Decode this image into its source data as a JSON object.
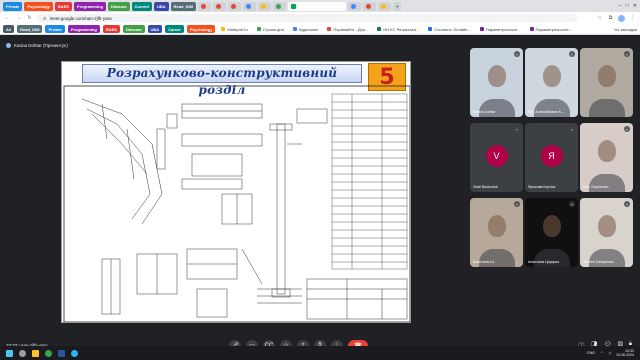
{
  "browser": {
    "tabs": [
      {
        "label": "Private",
        "color": "#1e88e5"
      },
      {
        "label": "Psychology",
        "color": "#f4511e"
      },
      {
        "label": "RAES",
        "color": "#e53935"
      },
      {
        "label": "Programming",
        "color": "#8e24aa"
      },
      {
        "label": "Dhasma",
        "color": "#43a047"
      },
      {
        "label": "Current",
        "color": "#00897b"
      },
      {
        "label": "UBA",
        "color": "#3949ab"
      },
      {
        "label": "Read_DIM",
        "color": "#546e7a"
      }
    ],
    "url": "meet.google.com/nan-zjfb-yasc",
    "bookmarks": [
      {
        "label": "All",
        "color": "#455a64",
        "colored": true
      },
      {
        "label": "Read_DIM",
        "color": "#546e7a",
        "colored": true
      },
      {
        "label": "Private",
        "color": "#1e88e5",
        "colored": true
      },
      {
        "label": "Programming",
        "color": "#8e24aa",
        "colored": true
      },
      {
        "label": "RAES",
        "color": "#e53935",
        "colored": true
      },
      {
        "label": "Dhasma",
        "color": "#43a047",
        "colored": true
      },
      {
        "label": "UBA",
        "color": "#3949ab",
        "colored": true
      },
      {
        "label": "Career",
        "color": "#00897b",
        "colored": true
      },
      {
        "label": "Psychology",
        "color": "#f4511e",
        "colored": true
      },
      {
        "label": "Mathprof.ru",
        "color": "#fbbc04",
        "colored": false
      },
      {
        "label": "Строки дня",
        "color": "#34a853",
        "colored": false
      },
      {
        "label": "Кудинопис",
        "color": "#4285f4",
        "colored": false
      },
      {
        "label": "Порівняйте - Дер...",
        "color": "#ea4335",
        "colored": false
      },
      {
        "label": "НН КС Рятувальн...",
        "color": "#0b8043",
        "colored": false
      },
      {
        "label": "Coursera: Онлайн...",
        "color": "#1a73e8",
        "colored": false
      },
      {
        "label": "Параметричносе...",
        "color": "#7b1fa2",
        "colored": false
      },
      {
        "label": "Параметричносте...",
        "color": "#7b1fa2",
        "colored": false
      }
    ],
    "all_bookmarks": "Усі закладки"
  },
  "meet": {
    "presenter": "Karina Dohtar (Презентує)",
    "meeting_code": "10:33 | nan-zjfb-yasc",
    "slide": {
      "title": "Розрахунково-конструктивний розділ",
      "number": "5"
    },
    "participants": [
      {
        "name": "Karina Dohtar",
        "kind": "video",
        "bg": "#c9d3de"
      },
      {
        "name": "Ігор Анатолійович К...",
        "kind": "video",
        "bg": "#cfd8dc"
      },
      {
        "name": "",
        "kind": "video",
        "bg": "#b0a9a0"
      },
      {
        "name": "Vladi Bochchuk",
        "kind": "letter",
        "letter": "V",
        "bg": "#3c4043"
      },
      {
        "name": "Ярослав Кортюк",
        "kind": "letter",
        "letter": "Я",
        "bg": "#3c4043"
      },
      {
        "name": "Alex Tkachenko",
        "kind": "video",
        "bg": "#d7ccc8"
      },
      {
        "name": "Анастасія Ш...",
        "kind": "video",
        "bg": "#b7a99a"
      },
      {
        "name": "Анастасія Ціцюрка",
        "kind": "video",
        "bg": "#101010"
      },
      {
        "name": "Yevhen Denysenko",
        "kind": "video",
        "bg": "#d8d3cc"
      }
    ]
  },
  "taskbar": {
    "time": "10:33",
    "date": "19.06.2024",
    "lang": "ENG"
  },
  "colors": {
    "accent": "#8ab4f8",
    "end_call": "#ea4335",
    "slide_title_text": "#1a3a8a",
    "slide_number_bg": "#f4a21a"
  }
}
